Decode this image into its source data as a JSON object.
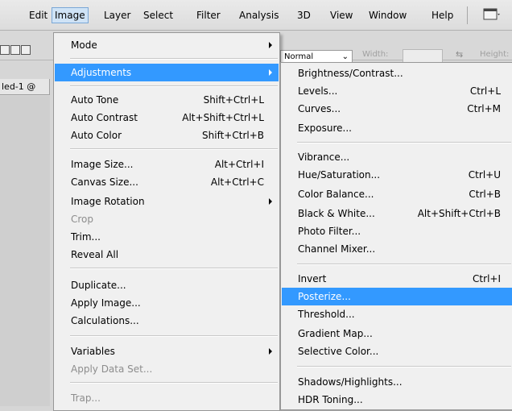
{
  "menubar": {
    "items": [
      "Edit",
      "Image",
      "Layer",
      "Select",
      "Filter",
      "Analysis",
      "3D",
      "View",
      "Window",
      "Help"
    ],
    "active": "Image"
  },
  "options_bar": {
    "mode_select": "Normal",
    "width_label": "Width:",
    "height_label": "Height:"
  },
  "document_tab": "led-1 @",
  "image_menu": {
    "items": [
      {
        "label": "Mode",
        "submenu": true
      },
      {
        "label": "Adjustments",
        "submenu": true,
        "highlighted": true
      },
      {
        "label": "Auto Tone",
        "shortcut": "Shift+Ctrl+L"
      },
      {
        "label": "Auto Contrast",
        "shortcut": "Alt+Shift+Ctrl+L"
      },
      {
        "label": "Auto Color",
        "shortcut": "Shift+Ctrl+B"
      },
      {
        "label": "Image Size...",
        "shortcut": "Alt+Ctrl+I"
      },
      {
        "label": "Canvas Size...",
        "shortcut": "Alt+Ctrl+C"
      },
      {
        "label": "Image Rotation",
        "submenu": true
      },
      {
        "label": "Crop",
        "disabled": true
      },
      {
        "label": "Trim..."
      },
      {
        "label": "Reveal All"
      },
      {
        "label": "Duplicate..."
      },
      {
        "label": "Apply Image..."
      },
      {
        "label": "Calculations..."
      },
      {
        "label": "Variables",
        "submenu": true
      },
      {
        "label": "Apply Data Set...",
        "disabled": true
      },
      {
        "label": "Trap...",
        "disabled": true
      }
    ]
  },
  "adjustments_menu": {
    "items": [
      {
        "label": "Brightness/Contrast..."
      },
      {
        "label": "Levels...",
        "shortcut": "Ctrl+L"
      },
      {
        "label": "Curves...",
        "shortcut": "Ctrl+M"
      },
      {
        "label": "Exposure..."
      },
      {
        "label": "Vibrance..."
      },
      {
        "label": "Hue/Saturation...",
        "shortcut": "Ctrl+U"
      },
      {
        "label": "Color Balance...",
        "shortcut": "Ctrl+B"
      },
      {
        "label": "Black & White...",
        "shortcut": "Alt+Shift+Ctrl+B"
      },
      {
        "label": "Photo Filter..."
      },
      {
        "label": "Channel Mixer..."
      },
      {
        "label": "Invert",
        "shortcut": "Ctrl+I"
      },
      {
        "label": "Posterize...",
        "highlighted": true
      },
      {
        "label": "Threshold..."
      },
      {
        "label": "Gradient Map..."
      },
      {
        "label": "Selective Color..."
      },
      {
        "label": "Shadows/Highlights..."
      },
      {
        "label": "HDR Toning..."
      }
    ]
  },
  "colors": {
    "highlight": "#3399ff",
    "menu_bg": "#f0f0f0",
    "disabled_text": "#8d8d8d"
  }
}
